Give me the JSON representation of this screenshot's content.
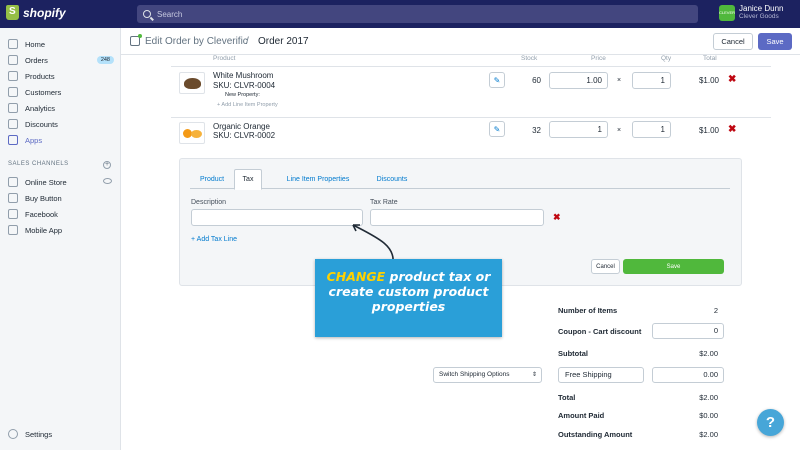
{
  "topbar": {
    "logo_text": "shopify",
    "search_placeholder": "Search",
    "user_name": "Janice Dunn",
    "store_name": "Clever Goods",
    "avatar_text": "CLEVER"
  },
  "sidebar": {
    "items": [
      {
        "label": "Home",
        "icon": "home-icon"
      },
      {
        "label": "Orders",
        "icon": "orders-icon",
        "badge": "248"
      },
      {
        "label": "Products",
        "icon": "tag-icon"
      },
      {
        "label": "Customers",
        "icon": "person-icon"
      },
      {
        "label": "Analytics",
        "icon": "chart-icon"
      },
      {
        "label": "Discounts",
        "icon": "discount-icon"
      },
      {
        "label": "Apps",
        "icon": "apps-icon",
        "active": true
      }
    ],
    "section_title": "SALES CHANNELS",
    "channels": [
      {
        "label": "Online Store",
        "icon": "store-icon"
      },
      {
        "label": "Buy Button",
        "icon": "code-icon"
      },
      {
        "label": "Facebook",
        "icon": "facebook-icon"
      },
      {
        "label": "Mobile App",
        "icon": "mobile-icon"
      }
    ],
    "settings_label": "Settings"
  },
  "header": {
    "breadcrumb": "Edit Order by Cleverific",
    "separator": "/",
    "title": "Order 2017",
    "cancel_label": "Cancel",
    "save_label": "Save"
  },
  "columns": {
    "product": "Product",
    "stock": "Stock",
    "price": "Price",
    "qty": "Qty",
    "total": "Total"
  },
  "line_items": [
    {
      "name": "White Mushroom",
      "sku": "SKU: CLVR-0004",
      "property": "New Property:",
      "add_property": "+ Add Line Item Property",
      "stock": "60",
      "price": "1.00",
      "times": "×",
      "qty": "1",
      "total": "$1.00",
      "delete": "✖"
    },
    {
      "name": "Organic Orange",
      "sku": "SKU: CLVR-0002",
      "stock": "32",
      "price": "1",
      "times": "×",
      "qty": "1",
      "total": "$1.00",
      "delete": "✖"
    }
  ],
  "panel": {
    "tabs": [
      "Product",
      "Tax",
      "Line Item Properties",
      "Discounts"
    ],
    "active_tab": "Tax",
    "description_label": "Description",
    "tax_rate_label": "Tax Rate",
    "description_value": "",
    "tax_rate_value": "",
    "delete": "✖",
    "add_tax_line": "+ Add Tax Line",
    "cancel_label": "Cancel",
    "save_label": "Save"
  },
  "callout": {
    "highlight": "CHANGE",
    "line1_rest": " product tax or",
    "line2": "create custom product",
    "line3": "properties"
  },
  "summary": {
    "items_label": "Number of Items",
    "items_value": "2",
    "coupon_label": "Coupon - Cart discount",
    "coupon_value": "0",
    "subtotal_label": "Subtotal",
    "subtotal_value": "$2.00",
    "shipping_select": "Switch Shipping Options",
    "shipping_name": "Free Shipping",
    "shipping_cost": "0.00",
    "total_label": "Total",
    "total_value": "$2.00",
    "paid_label": "Amount Paid",
    "paid_value": "$0.00",
    "outstanding_label": "Outstanding Amount",
    "outstanding_value": "$2.00"
  },
  "help_label": "?",
  "colors": {
    "topbar": "#1c2260",
    "accent": "#5c6ac4",
    "save_green": "#50b83c",
    "callout_blue": "#2a9fd8",
    "callout_yellow": "#ffd100",
    "delete_red": "#bf0711"
  }
}
